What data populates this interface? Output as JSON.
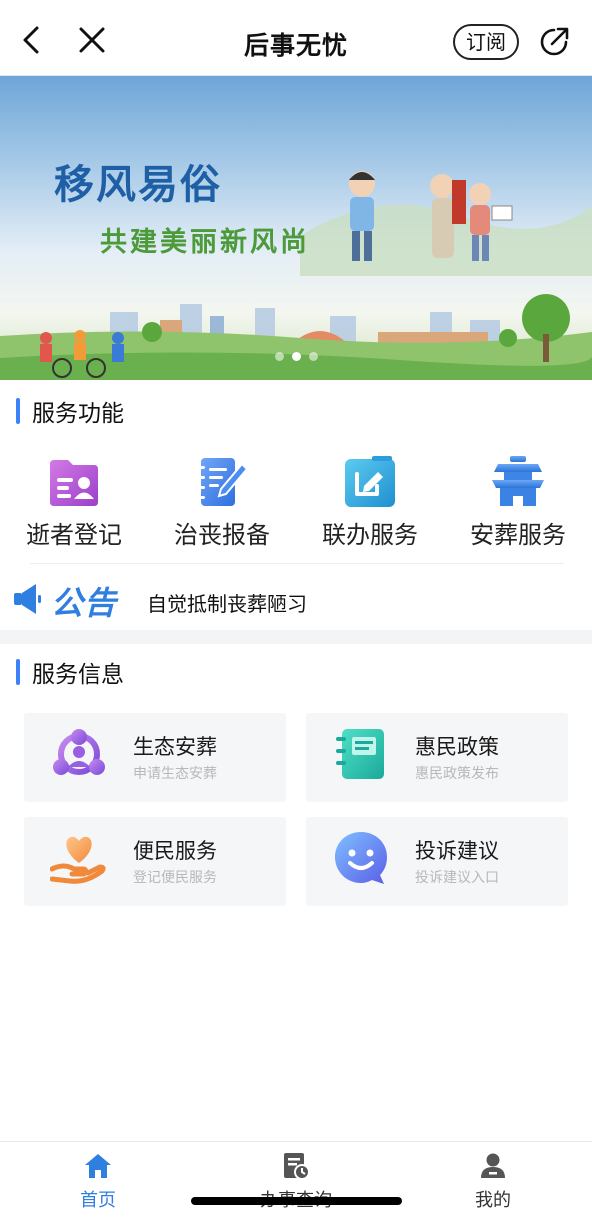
{
  "header": {
    "title": "后事无忧",
    "subscribe_label": "订阅",
    "icons": {
      "back": "chevron-left-icon",
      "close": "close-icon",
      "share": "share-icon"
    }
  },
  "banner": {
    "title": "移风易俗",
    "subtitle": "共建美丽新风尚",
    "slide_count": 3,
    "active_slide": 2
  },
  "services": {
    "heading": "服务功能",
    "items": [
      {
        "label": "逝者登记",
        "icon": "id-card-icon",
        "color": "#b35bd6"
      },
      {
        "label": "治丧报备",
        "icon": "notebook-pen-icon",
        "color": "#4c8af0"
      },
      {
        "label": "联办服务",
        "icon": "edit-square-icon",
        "color": "#2fa7dd"
      },
      {
        "label": "安葬服务",
        "icon": "pavilion-icon",
        "color": "#3c86e8"
      }
    ]
  },
  "notice": {
    "tag": "公告",
    "text": "自觉抵制丧葬陋习"
  },
  "info": {
    "heading": "服务信息",
    "cards": [
      {
        "title": "生态安葬",
        "subtitle": "申请生态安葬",
        "icon": "people-network-icon"
      },
      {
        "title": "惠民政策",
        "subtitle": "惠民政策发布",
        "icon": "notebook-icon"
      },
      {
        "title": "便民服务",
        "subtitle": "登记便民服务",
        "icon": "heart-hand-icon"
      },
      {
        "title": "投诉建议",
        "subtitle": "投诉建议入口",
        "icon": "smile-chat-icon"
      }
    ]
  },
  "tabbar": {
    "items": [
      {
        "label": "首页",
        "icon": "home-icon",
        "active": true
      },
      {
        "label": "办事查询",
        "icon": "document-clock-icon",
        "active": false
      },
      {
        "label": "我的",
        "icon": "user-icon",
        "active": false
      }
    ]
  },
  "colors": {
    "accent": "#2f7fe0",
    "card_bg": "#f5f6f8"
  }
}
